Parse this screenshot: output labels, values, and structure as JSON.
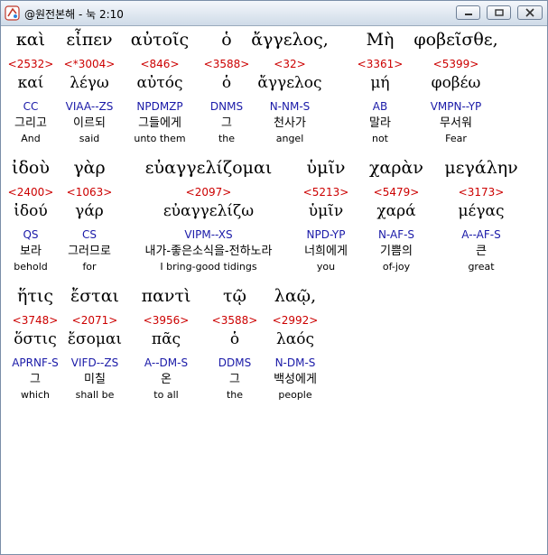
{
  "window": {
    "title": "@원전본해 - 눅 2:10"
  },
  "rows": [
    {
      "words": [
        {
          "greek": "καὶ",
          "strong": "<2532>",
          "lemma": "καί",
          "parse": "CC",
          "korean": "그리고",
          "english": "And"
        },
        {
          "greek": "εἶπεν",
          "strong": "<*3004>",
          "lemma": "λέγω",
          "parse": "VIAA--ZS",
          "korean": "이르되",
          "english": "said"
        },
        {
          "greek": "αὐτοῖς",
          "strong": "<846>",
          "lemma": "αὐτός",
          "parse": "NPDMZP",
          "korean": "그들에게",
          "english": "unto them"
        },
        {
          "greek": "ὁ",
          "strong": "<3588>",
          "lemma": "ὁ",
          "parse": "DNMS",
          "korean": "그",
          "english": "the"
        },
        {
          "greek": "ἄγγελος,",
          "strong": "<32>",
          "lemma": "ἄγγελος",
          "parse": "N-NM-S",
          "korean": "천사가",
          "english": "angel"
        },
        {
          "greek": "Μὴ",
          "strong": "<3361>",
          "lemma": "μή",
          "parse": "AB",
          "korean": "말라",
          "english": "not"
        },
        {
          "greek": "φοβεῖσθε,",
          "strong": "<5399>",
          "lemma": "φοβέω",
          "parse": "VMPN--YP",
          "korean": "무서워",
          "english": "Fear"
        }
      ]
    },
    {
      "words": [
        {
          "greek": "ἰδοὺ",
          "strong": "<2400>",
          "lemma": "ἰδού",
          "parse": "QS",
          "korean": "보라",
          "english": "behold"
        },
        {
          "greek": "γὰρ",
          "strong": "<1063>",
          "lemma": "γάρ",
          "parse": "CS",
          "korean": "그러므로",
          "english": "for"
        },
        {
          "greek": "εὐαγγελίζομαι",
          "strong": "<2097>",
          "lemma": "εὐαγγελίζω",
          "parse": "VIPM--XS",
          "korean": "내가-좋은소식을-전하노라",
          "english": "I bring-good tidings"
        },
        {
          "greek": "ὑμῖν",
          "strong": "<5213>",
          "lemma": "ὑμῖν",
          "parse": "NPD-YP",
          "korean": "너희에게",
          "english": "you"
        },
        {
          "greek": "χαρὰν",
          "strong": "<5479>",
          "lemma": "χαρά",
          "parse": "N-AF-S",
          "korean": "기쁨의",
          "english": "of-joy"
        },
        {
          "greek": "μεγάλην",
          "strong": "<3173>",
          "lemma": "μέγας",
          "parse": "A--AF-S",
          "korean": "큰",
          "english": "great"
        }
      ]
    },
    {
      "words": [
        {
          "greek": "ἥτις",
          "strong": "<3748>",
          "lemma": "ὅστις",
          "parse": "APRNF-S",
          "korean": "그",
          "english": "which"
        },
        {
          "greek": "ἔσται",
          "strong": "<2071>",
          "lemma": "ἔσομαι",
          "parse": "VIFD--ZS",
          "korean": "미칠",
          "english": "shall be"
        },
        {
          "greek": "παντὶ",
          "strong": "<3956>",
          "lemma": "πᾶς",
          "parse": "A--DM-S",
          "korean": "온",
          "english": "to all"
        },
        {
          "greek": "τῷ",
          "strong": "<3588>",
          "lemma": "ὁ",
          "parse": "DDMS",
          "korean": "그",
          "english": "the"
        },
        {
          "greek": "λαῷ,",
          "strong": "<2992>",
          "lemma": "λαός",
          "parse": "N-DM-S",
          "korean": "백성에게",
          "english": "people"
        }
      ]
    }
  ]
}
